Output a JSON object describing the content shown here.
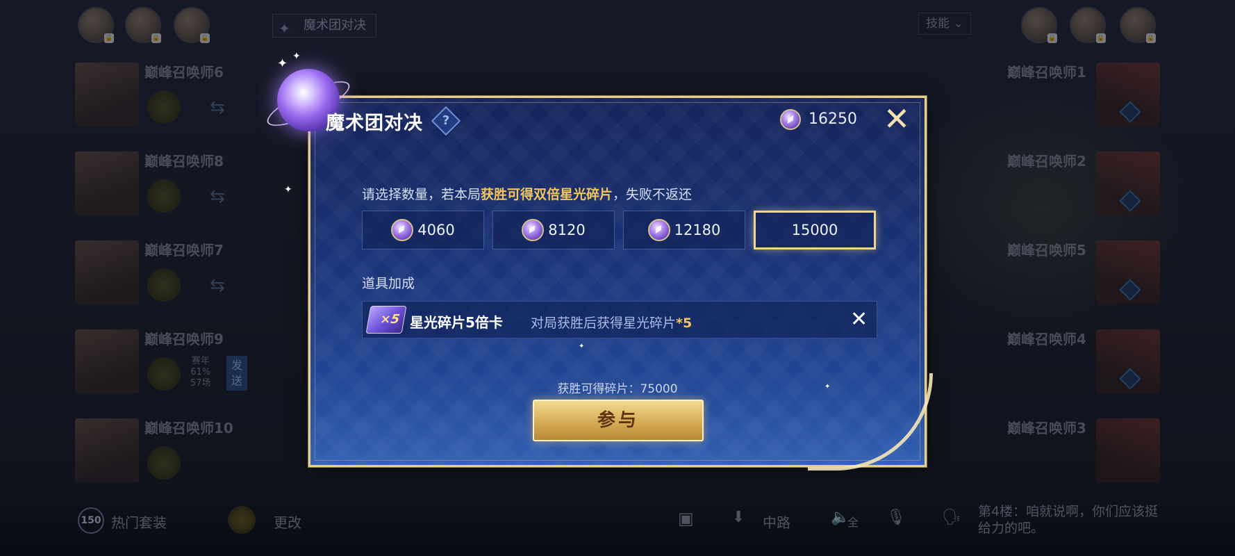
{
  "top": {
    "mode_tag": "魔术团对决",
    "skill_dropdown": "技能 ⌄"
  },
  "left_players": [
    {
      "name": "巅峰召唤师6"
    },
    {
      "name": "巅峰召唤师8"
    },
    {
      "name": "巅峰召唤师7"
    },
    {
      "name": "巅峰召唤师9",
      "stats": [
        "赛年",
        "61%",
        "57场"
      ],
      "send": "发送"
    },
    {
      "name": "巅峰召唤师10"
    }
  ],
  "right_players": [
    {
      "name": "巅峰召唤师1"
    },
    {
      "name": "巅峰召唤师2"
    },
    {
      "name": "巅峰召唤师5"
    },
    {
      "name": "巅峰召唤师4"
    },
    {
      "name": "巅峰召唤师3"
    }
  ],
  "bottom": {
    "level": "150",
    "hot_set": "热门套装",
    "change": "更改",
    "lane": "中路",
    "voice_all": "全",
    "chat": "第4楼：咱就说啊，你们应该挺给力的吧。"
  },
  "modal": {
    "title": "魔术团对决",
    "help": "?",
    "balance": "16250",
    "close": "✕",
    "prompt_pre": "请选择数量，若本局",
    "prompt_highlight": "获胜可得双倍星光碎片",
    "prompt_post": "，失败不返还",
    "options": [
      {
        "value": "4060",
        "selected": false
      },
      {
        "value": "8120",
        "selected": false
      },
      {
        "value": "12180",
        "selected": false
      },
      {
        "value": "15000",
        "selected": true
      }
    ],
    "bonus_label": "道具加成",
    "item": {
      "badge": "×5",
      "name": "星光碎片5倍卡",
      "desc": "对局获胜后获得星光碎片",
      "mult": "*5",
      "remove": "✕"
    },
    "win_total": "获胜可得碎片：75000",
    "join": "参与"
  }
}
